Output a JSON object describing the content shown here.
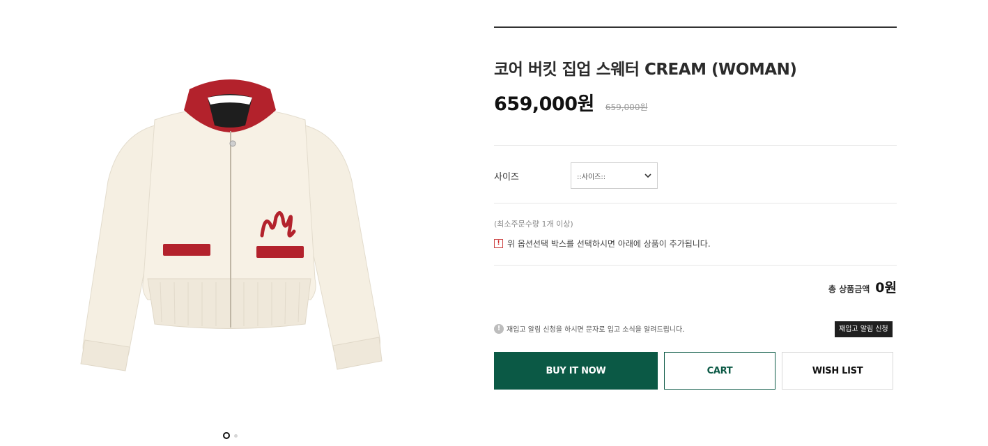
{
  "product": {
    "title": "코어 버킷 집업 스웨터 CREAM (WOMAN)",
    "price": "659,000원",
    "original_price": "659,000원"
  },
  "options": {
    "size_label": "사이즈",
    "size_selected": "::사이즈::",
    "min_order": "(최소주문수량 1개 이상)",
    "notice": "위 옵션선택 박스를 선택하시면 아래에 상품이 추가됩니다."
  },
  "total": {
    "label": "총 상품금액",
    "value": "0원"
  },
  "restock": {
    "text": "재입고 알림 신청을 하시면 문자로 입고 소식을 알려드립니다.",
    "button": "재입고 알림 신청"
  },
  "buttons": {
    "buy": "BUY IT NOW",
    "cart": "CART",
    "wish": "WISH LIST"
  },
  "gallery": {
    "slide_count": 2,
    "active_slide": 1
  },
  "colors": {
    "accent": "#0b5945",
    "sweater_body": "#f5efe2",
    "sweater_trim": "#b3222c"
  },
  "icons": {
    "warning": "warning-icon",
    "info": "info-icon",
    "dropdown": "chevron-down-icon"
  }
}
